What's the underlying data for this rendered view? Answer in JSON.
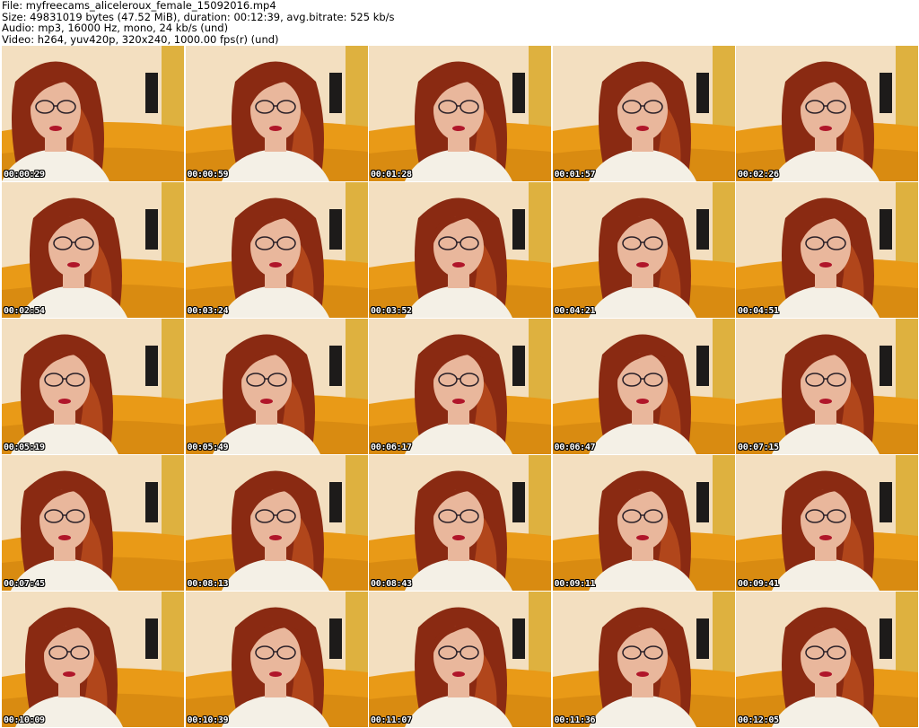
{
  "header": {
    "file": "File: myfreecams_aliceleroux_female_15092016.mp4",
    "size": "Size: 49831019 bytes (47.52 MiB), duration: 00:12:39, avg.bitrate: 525 kb/s",
    "audio": "Audio: mp3, 16000 Hz, mono, 24 kb/s (und)",
    "video": "Video: h264, yuv420p, 320x240, 1000.00 fps(r) (und)"
  },
  "thumbnails": [
    {
      "timestamp": "00:00:29"
    },
    {
      "timestamp": "00:00:59"
    },
    {
      "timestamp": "00:01:28"
    },
    {
      "timestamp": "00:01:57"
    },
    {
      "timestamp": "00:02:26"
    },
    {
      "timestamp": "00:02:54"
    },
    {
      "timestamp": "00:03:24"
    },
    {
      "timestamp": "00:03:52"
    },
    {
      "timestamp": "00:04:21"
    },
    {
      "timestamp": "00:04:51"
    },
    {
      "timestamp": "00:05:19"
    },
    {
      "timestamp": "00:05:49"
    },
    {
      "timestamp": "00:06:17"
    },
    {
      "timestamp": "00:06:47"
    },
    {
      "timestamp": "00:07:15"
    },
    {
      "timestamp": "00:07:45"
    },
    {
      "timestamp": "00:08:13"
    },
    {
      "timestamp": "00:08:43"
    },
    {
      "timestamp": "00:09:11"
    },
    {
      "timestamp": "00:09:41"
    },
    {
      "timestamp": "00:10:09"
    },
    {
      "timestamp": "00:10:39"
    },
    {
      "timestamp": "00:11:07"
    },
    {
      "timestamp": "00:11:36"
    },
    {
      "timestamp": "00:12:05"
    }
  ],
  "colors": {
    "wall": "#f3dfc0",
    "wallpaper_gold": "#d9a928",
    "sofa": "#e99a17",
    "sofa_shadow": "#c97b0c",
    "hair": "#8a2a12",
    "hair_light": "#c2521f",
    "skin": "#e9b79c",
    "shirt": "#f4f0e6",
    "lips": "#b0162a",
    "speaker": "#1d1b1a",
    "glasses": "#2a2028"
  }
}
